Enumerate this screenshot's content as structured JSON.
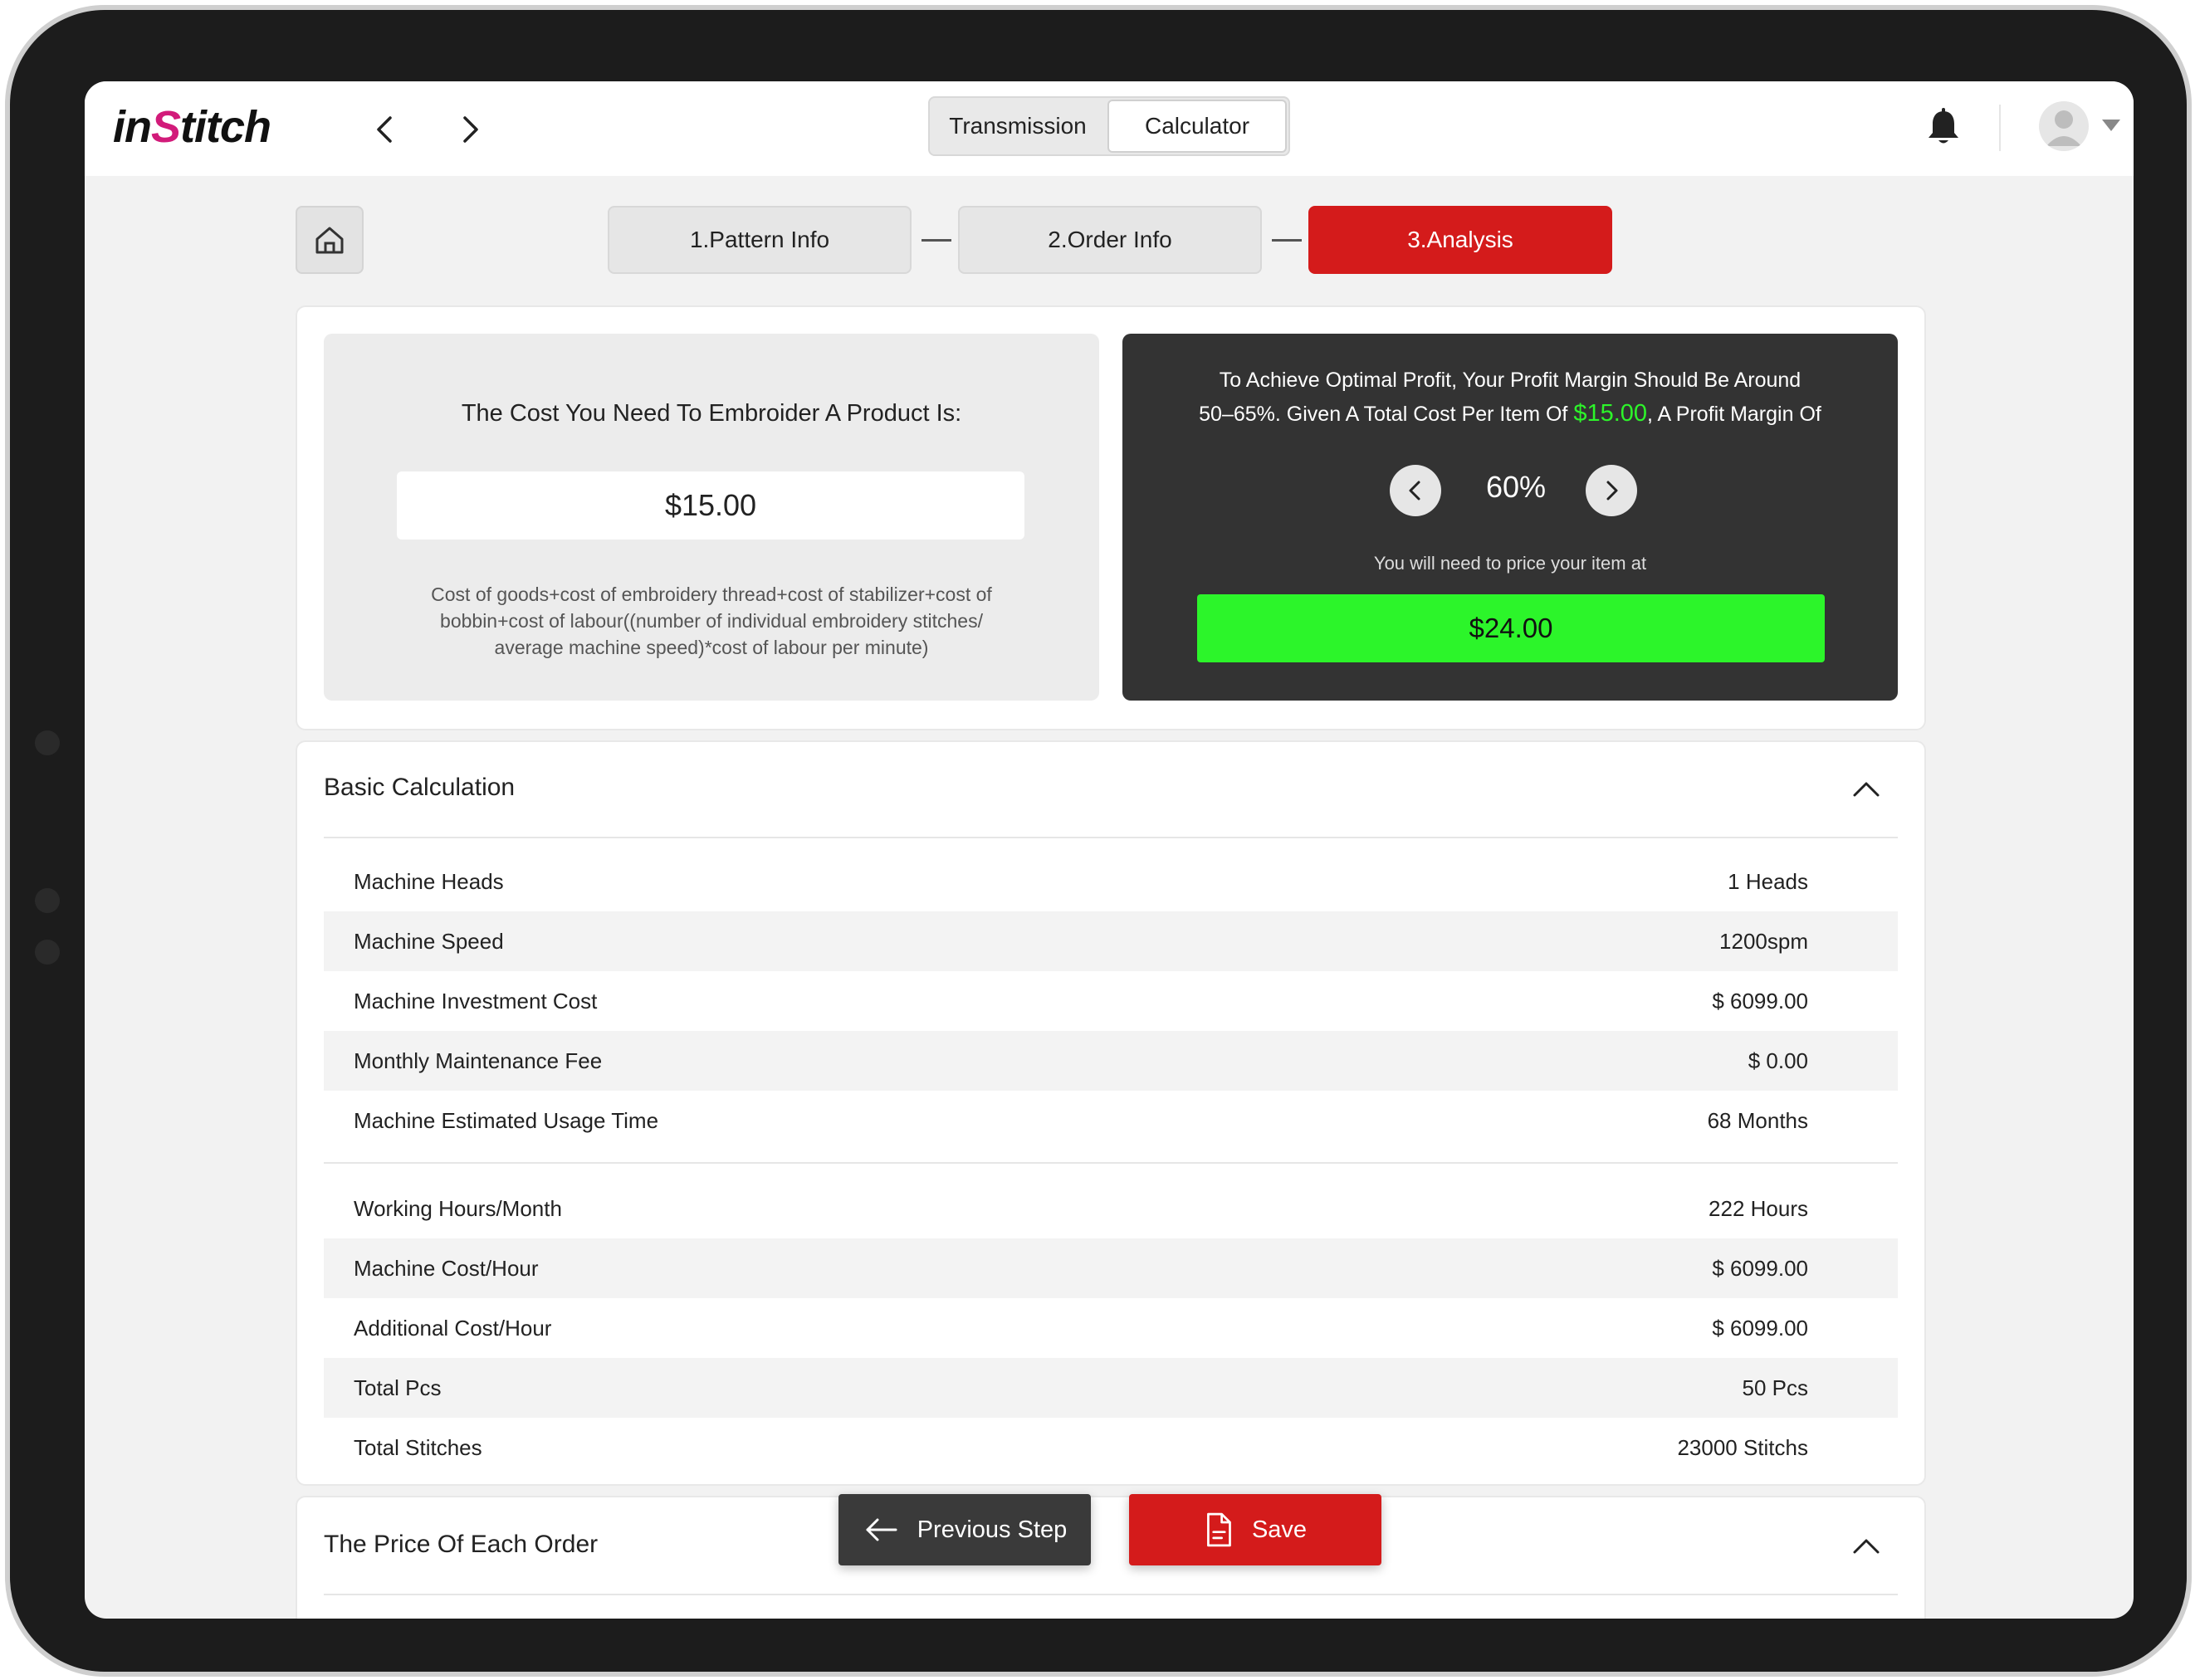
{
  "app": {
    "logo_prefix": "in",
    "logo_s": "S",
    "logo_suffix": "titch"
  },
  "header": {
    "tabs": [
      {
        "label": "Transmission",
        "active": false
      },
      {
        "label": "Calculator",
        "active": true
      }
    ]
  },
  "steps": [
    {
      "label": "1.Pattern Info",
      "active": false
    },
    {
      "label": "2.Order Info",
      "active": false
    },
    {
      "label": "3.Analysis",
      "active": true
    }
  ],
  "cost_panel": {
    "title": "The Cost You Need To Embroider A Product Is:",
    "value": "$15.00",
    "formula_line1": "Cost of goods+cost of embroidery thread+cost of stabilizer+cost of",
    "formula_line2": "bobbin+cost of labour((number of individual embroidery stitches/",
    "formula_line3": "average machine speed)*cost of labour per minute)"
  },
  "profit_panel": {
    "text_line1": "To Achieve Optimal Profit, Your Profit Margin Should Be Around",
    "text_line2_a": "50–65%. Given A Total Cost Per Item Of ",
    "text_highlight": "$15.00",
    "text_line2_b": ", A Profit Margin Of",
    "margin": "60%",
    "need_price_text": "You will need to price your item at",
    "price": "$24.00"
  },
  "basic_calculation": {
    "title": "Basic Calculation",
    "group1": [
      {
        "label": "Machine Heads",
        "value": "1 Heads"
      },
      {
        "label": "Machine Speed",
        "value": "1200spm"
      },
      {
        "label": "Machine Investment Cost",
        "value": "$ 6099.00"
      },
      {
        "label": "Monthly Maintenance Fee",
        "value": "$ 0.00"
      },
      {
        "label": "Machine Estimated Usage Time",
        "value": "68 Months"
      }
    ],
    "group2": [
      {
        "label": "Working Hours/Month",
        "value": "222 Hours"
      },
      {
        "label": "Machine Cost/Hour",
        "value": "$ 6099.00"
      },
      {
        "label": "Additional Cost/Hour",
        "value": "$ 6099.00"
      },
      {
        "label": "Total Pcs",
        "value": "50 Pcs"
      },
      {
        "label": "Total Stitches",
        "value": "23000 Stitchs"
      }
    ]
  },
  "price_section": {
    "title": "The Price Of Each Order"
  },
  "actions": {
    "previous_label": "Previous Step",
    "save_label": "Save"
  },
  "colors": {
    "accent_red": "#d41b1b",
    "price_green": "#2cf52a",
    "dark_panel": "#333333"
  }
}
